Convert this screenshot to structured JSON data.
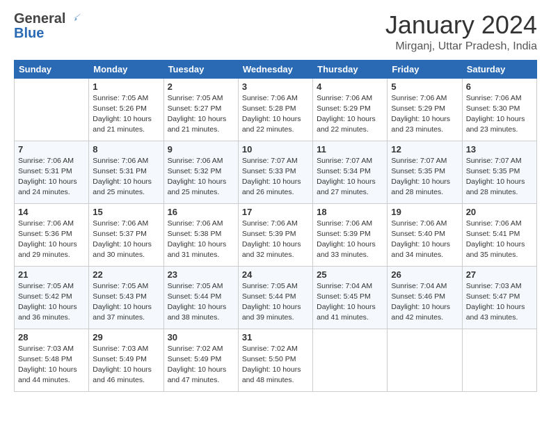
{
  "header": {
    "logo_general": "General",
    "logo_blue": "Blue",
    "month_title": "January 2024",
    "location": "Mirganj, Uttar Pradesh, India"
  },
  "weekdays": [
    "Sunday",
    "Monday",
    "Tuesday",
    "Wednesday",
    "Thursday",
    "Friday",
    "Saturday"
  ],
  "weeks": [
    [
      {
        "day": "",
        "sunrise": "",
        "sunset": "",
        "daylight": ""
      },
      {
        "day": "1",
        "sunrise": "Sunrise: 7:05 AM",
        "sunset": "Sunset: 5:26 PM",
        "daylight": "Daylight: 10 hours and 21 minutes."
      },
      {
        "day": "2",
        "sunrise": "Sunrise: 7:05 AM",
        "sunset": "Sunset: 5:27 PM",
        "daylight": "Daylight: 10 hours and 21 minutes."
      },
      {
        "day": "3",
        "sunrise": "Sunrise: 7:06 AM",
        "sunset": "Sunset: 5:28 PM",
        "daylight": "Daylight: 10 hours and 22 minutes."
      },
      {
        "day": "4",
        "sunrise": "Sunrise: 7:06 AM",
        "sunset": "Sunset: 5:29 PM",
        "daylight": "Daylight: 10 hours and 22 minutes."
      },
      {
        "day": "5",
        "sunrise": "Sunrise: 7:06 AM",
        "sunset": "Sunset: 5:29 PM",
        "daylight": "Daylight: 10 hours and 23 minutes."
      },
      {
        "day": "6",
        "sunrise": "Sunrise: 7:06 AM",
        "sunset": "Sunset: 5:30 PM",
        "daylight": "Daylight: 10 hours and 23 minutes."
      }
    ],
    [
      {
        "day": "7",
        "sunrise": "Sunrise: 7:06 AM",
        "sunset": "Sunset: 5:31 PM",
        "daylight": "Daylight: 10 hours and 24 minutes."
      },
      {
        "day": "8",
        "sunrise": "Sunrise: 7:06 AM",
        "sunset": "Sunset: 5:31 PM",
        "daylight": "Daylight: 10 hours and 25 minutes."
      },
      {
        "day": "9",
        "sunrise": "Sunrise: 7:06 AM",
        "sunset": "Sunset: 5:32 PM",
        "daylight": "Daylight: 10 hours and 25 minutes."
      },
      {
        "day": "10",
        "sunrise": "Sunrise: 7:07 AM",
        "sunset": "Sunset: 5:33 PM",
        "daylight": "Daylight: 10 hours and 26 minutes."
      },
      {
        "day": "11",
        "sunrise": "Sunrise: 7:07 AM",
        "sunset": "Sunset: 5:34 PM",
        "daylight": "Daylight: 10 hours and 27 minutes."
      },
      {
        "day": "12",
        "sunrise": "Sunrise: 7:07 AM",
        "sunset": "Sunset: 5:35 PM",
        "daylight": "Daylight: 10 hours and 28 minutes."
      },
      {
        "day": "13",
        "sunrise": "Sunrise: 7:07 AM",
        "sunset": "Sunset: 5:35 PM",
        "daylight": "Daylight: 10 hours and 28 minutes."
      }
    ],
    [
      {
        "day": "14",
        "sunrise": "Sunrise: 7:06 AM",
        "sunset": "Sunset: 5:36 PM",
        "daylight": "Daylight: 10 hours and 29 minutes."
      },
      {
        "day": "15",
        "sunrise": "Sunrise: 7:06 AM",
        "sunset": "Sunset: 5:37 PM",
        "daylight": "Daylight: 10 hours and 30 minutes."
      },
      {
        "day": "16",
        "sunrise": "Sunrise: 7:06 AM",
        "sunset": "Sunset: 5:38 PM",
        "daylight": "Daylight: 10 hours and 31 minutes."
      },
      {
        "day": "17",
        "sunrise": "Sunrise: 7:06 AM",
        "sunset": "Sunset: 5:39 PM",
        "daylight": "Daylight: 10 hours and 32 minutes."
      },
      {
        "day": "18",
        "sunrise": "Sunrise: 7:06 AM",
        "sunset": "Sunset: 5:39 PM",
        "daylight": "Daylight: 10 hours and 33 minutes."
      },
      {
        "day": "19",
        "sunrise": "Sunrise: 7:06 AM",
        "sunset": "Sunset: 5:40 PM",
        "daylight": "Daylight: 10 hours and 34 minutes."
      },
      {
        "day": "20",
        "sunrise": "Sunrise: 7:06 AM",
        "sunset": "Sunset: 5:41 PM",
        "daylight": "Daylight: 10 hours and 35 minutes."
      }
    ],
    [
      {
        "day": "21",
        "sunrise": "Sunrise: 7:05 AM",
        "sunset": "Sunset: 5:42 PM",
        "daylight": "Daylight: 10 hours and 36 minutes."
      },
      {
        "day": "22",
        "sunrise": "Sunrise: 7:05 AM",
        "sunset": "Sunset: 5:43 PM",
        "daylight": "Daylight: 10 hours and 37 minutes."
      },
      {
        "day": "23",
        "sunrise": "Sunrise: 7:05 AM",
        "sunset": "Sunset: 5:44 PM",
        "daylight": "Daylight: 10 hours and 38 minutes."
      },
      {
        "day": "24",
        "sunrise": "Sunrise: 7:05 AM",
        "sunset": "Sunset: 5:44 PM",
        "daylight": "Daylight: 10 hours and 39 minutes."
      },
      {
        "day": "25",
        "sunrise": "Sunrise: 7:04 AM",
        "sunset": "Sunset: 5:45 PM",
        "daylight": "Daylight: 10 hours and 41 minutes."
      },
      {
        "day": "26",
        "sunrise": "Sunrise: 7:04 AM",
        "sunset": "Sunset: 5:46 PM",
        "daylight": "Daylight: 10 hours and 42 minutes."
      },
      {
        "day": "27",
        "sunrise": "Sunrise: 7:03 AM",
        "sunset": "Sunset: 5:47 PM",
        "daylight": "Daylight: 10 hours and 43 minutes."
      }
    ],
    [
      {
        "day": "28",
        "sunrise": "Sunrise: 7:03 AM",
        "sunset": "Sunset: 5:48 PM",
        "daylight": "Daylight: 10 hours and 44 minutes."
      },
      {
        "day": "29",
        "sunrise": "Sunrise: 7:03 AM",
        "sunset": "Sunset: 5:49 PM",
        "daylight": "Daylight: 10 hours and 46 minutes."
      },
      {
        "day": "30",
        "sunrise": "Sunrise: 7:02 AM",
        "sunset": "Sunset: 5:49 PM",
        "daylight": "Daylight: 10 hours and 47 minutes."
      },
      {
        "day": "31",
        "sunrise": "Sunrise: 7:02 AM",
        "sunset": "Sunset: 5:50 PM",
        "daylight": "Daylight: 10 hours and 48 minutes."
      },
      {
        "day": "",
        "sunrise": "",
        "sunset": "",
        "daylight": ""
      },
      {
        "day": "",
        "sunrise": "",
        "sunset": "",
        "daylight": ""
      },
      {
        "day": "",
        "sunrise": "",
        "sunset": "",
        "daylight": ""
      }
    ]
  ],
  "colors": {
    "header_bg": "#2a6ab5",
    "header_text": "#ffffff",
    "row_even": "#f5f8fc",
    "row_odd": "#ffffff",
    "border": "#cccccc",
    "text": "#333333",
    "title": "#333333",
    "location": "#555555"
  }
}
